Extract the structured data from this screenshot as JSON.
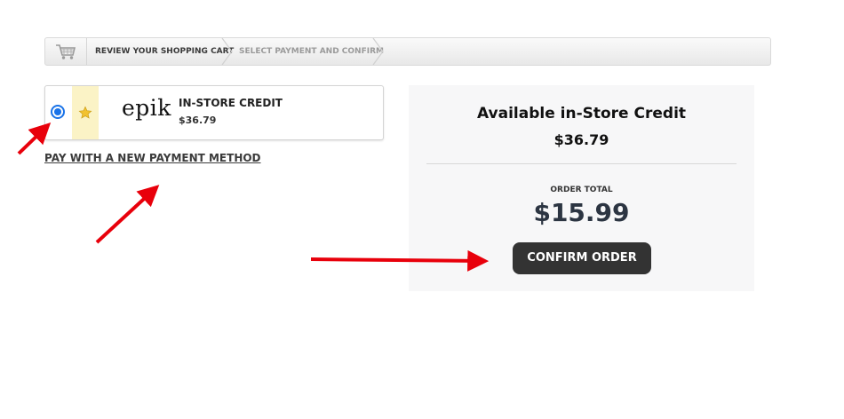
{
  "breadcrumb": {
    "step1": "REVIEW YOUR SHOPPING CART",
    "step2": "SELECT PAYMENT AND CONFIRM"
  },
  "payment_option": {
    "logo_text": "epik",
    "title": "IN-STORE CREDIT",
    "amount": "$36.79",
    "selected": true
  },
  "new_method_link": "PAY WITH A NEW PAYMENT METHOD",
  "summary": {
    "title": "Available in-Store Credit",
    "credit": "$36.79",
    "order_total_label": "ORDER TOTAL",
    "order_total": "$15.99",
    "confirm_label": "CONFIRM ORDER"
  },
  "colors": {
    "annotation_arrow": "#e8000b",
    "radio": "#1a73e8",
    "confirm_bg": "#333333"
  },
  "icons": [
    "shopping-cart-icon",
    "star-icon"
  ]
}
